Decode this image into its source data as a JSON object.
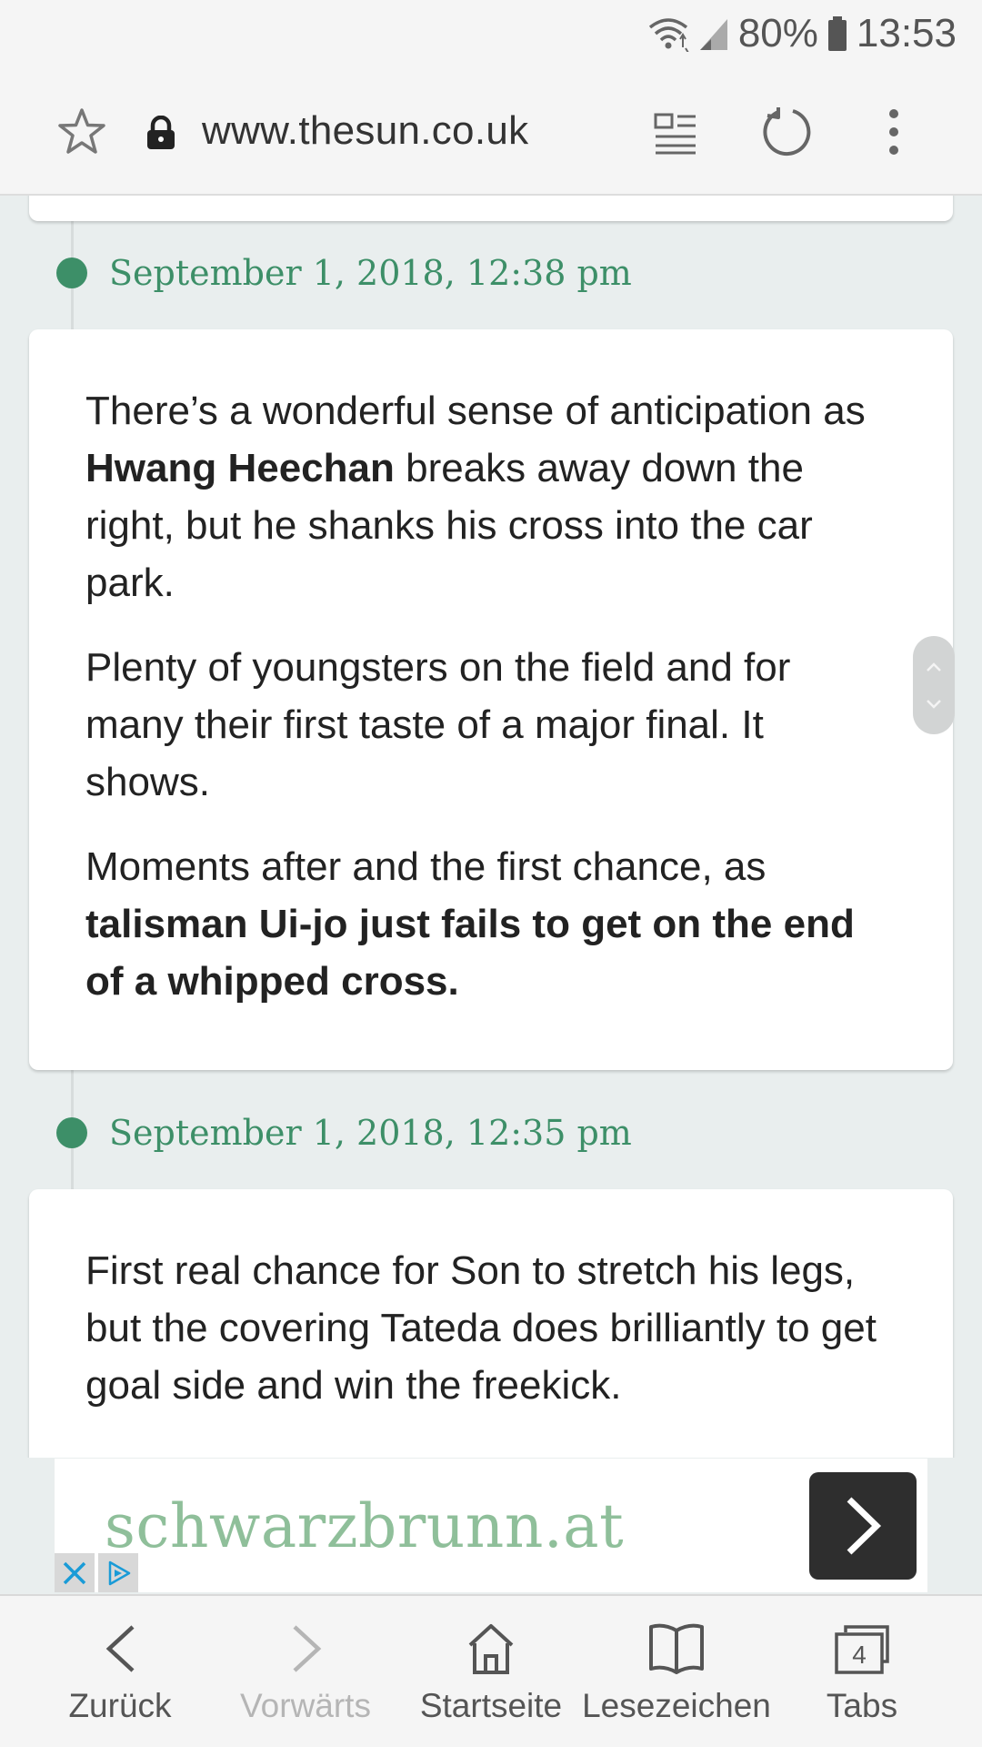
{
  "status_bar": {
    "battery": "80%",
    "time": "13:53"
  },
  "url_bar": {
    "url": "www.thesun.co.uk"
  },
  "entries": [
    {
      "time": "September 1, 2018, 12:38 pm",
      "p1": {
        "a": "There’s a wonderful sense of anticipation as ",
        "b": "Hwang Heechan",
        "c": " breaks away down the right, but he shanks his cross into the car park."
      },
      "p2": "Plenty of youngsters on the field and for many their first taste of a major final. It shows.",
      "p3": {
        "a": "Moments after and the first chance, as ",
        "b": "talisman Ui-jo just fails to get on the end of a whipped cross."
      }
    },
    {
      "time": "September 1, 2018, 12:35 pm",
      "p1": "First real chance for Son to stretch his legs, but the covering Tateda does brilliantly to get goal side and win the freekick."
    }
  ],
  "ad": {
    "text": "schwarzbrunn.at"
  },
  "bottom_nav": {
    "back": "Zurück",
    "forward": "Vorwärts",
    "home": "Startseite",
    "bookmarks": "Lesezeichen",
    "tabs": "Tabs",
    "tab_count": "4"
  },
  "colors": {
    "accent_green": "#3d8f68",
    "accent_red": "#d9261c",
    "ad_green": "#8fbf9a"
  }
}
